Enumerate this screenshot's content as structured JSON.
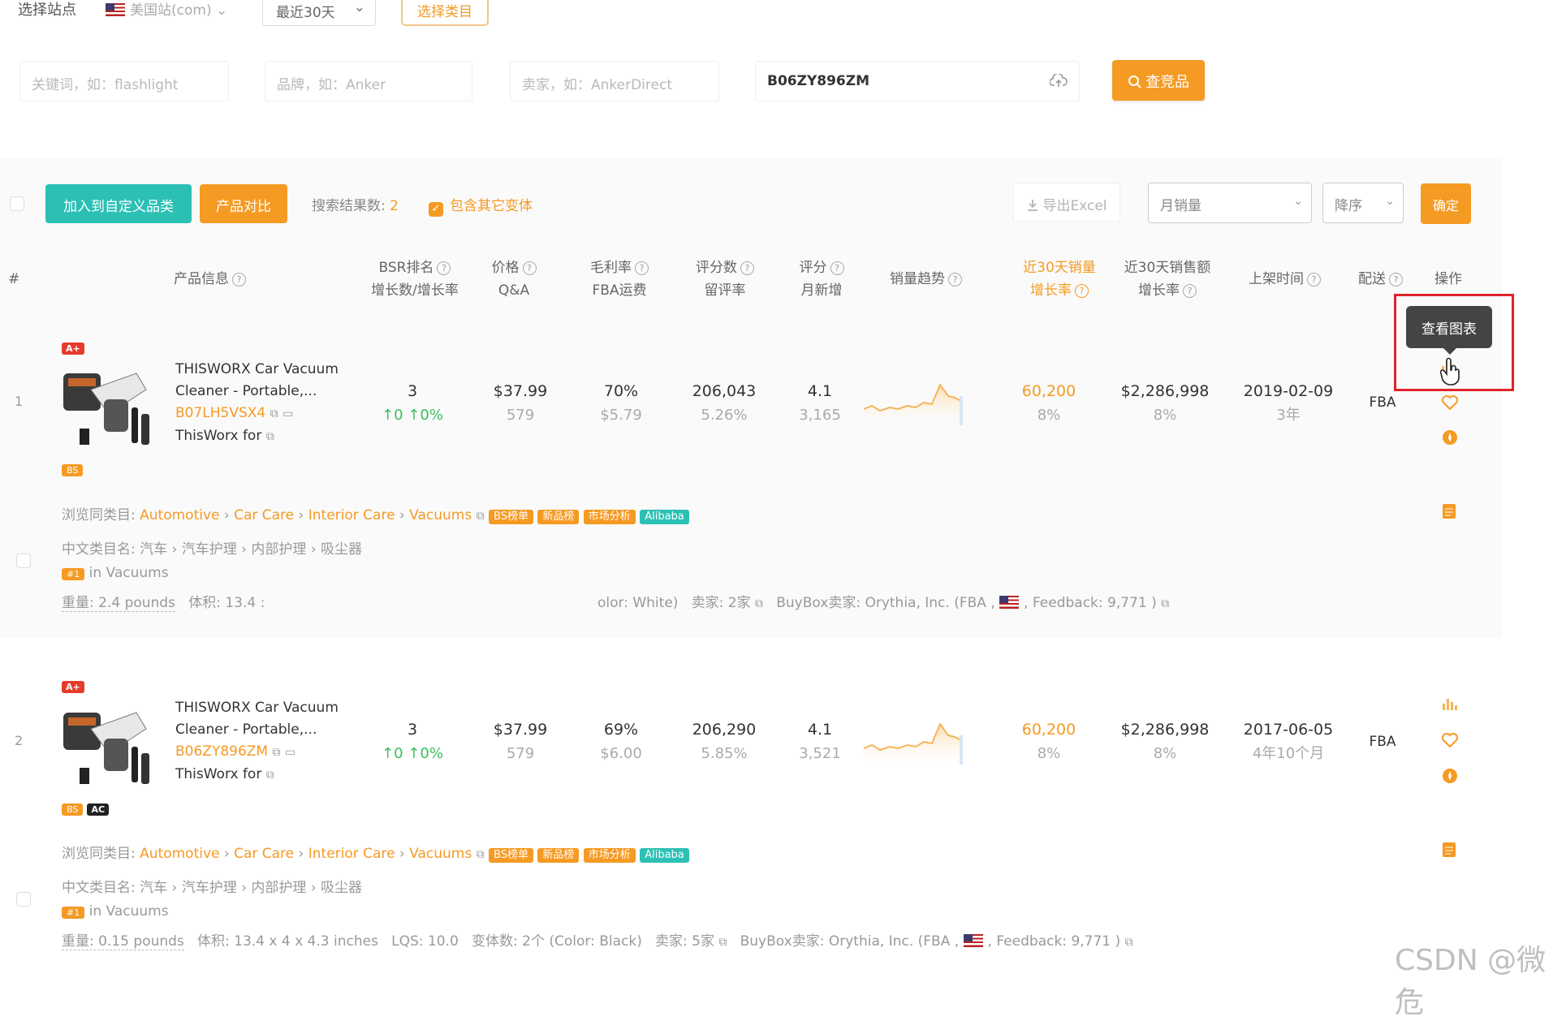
{
  "filters": {
    "site_label": "选择站点",
    "site_value": "美国站(com)",
    "range_value": "最近30天",
    "category_button": "选择类目"
  },
  "search": {
    "keyword_placeholder": "关键词，如：flashlight",
    "brand_placeholder": "品牌，如：Anker",
    "seller_placeholder": "卖家，如：AnkerDirect",
    "asin_value": "B06ZY896ZM",
    "query_button": "查竞品"
  },
  "toolbar": {
    "add_custom_category": "加入到自定义品类",
    "compare_products": "产品对比",
    "results_label": "搜索结果数:",
    "results_count": "2",
    "include_variants": "包含其它变体",
    "export_excel": "导出Excel",
    "sort_field": "月销量",
    "sort_order": "降序",
    "confirm": "确定"
  },
  "headers": {
    "index": "#",
    "product_info": "产品信息",
    "bsr_1": "BSR排名",
    "bsr_2": "增长数/增长率",
    "price_1": "价格",
    "price_2": "Q&A",
    "margin_1": "毛利率",
    "margin_2": "FBA运费",
    "reviews_1": "评分数",
    "reviews_2": "留评率",
    "rating_1": "评分",
    "rating_2": "月新增",
    "trend": "销量趋势",
    "sales30_1": "近30天销量",
    "sales30_2": "增长率",
    "revenue30_1": "近30天销售额",
    "revenue30_2": "增长率",
    "launch": "上架时间",
    "delivery": "配送",
    "actions": "操作"
  },
  "tooltip": "查看图表",
  "rows": [
    {
      "index": "1",
      "badge_top": "A+",
      "title_1": "THISWORX Car Vacuum",
      "title_2": "Cleaner - Portable,...",
      "asin": "B07LH5VSX4",
      "brand_line": "ThisWorx for",
      "badges_bottom": [
        "BS"
      ],
      "bsr": "3",
      "bsr_growth": "↑0  ↑0%",
      "price": "$37.99",
      "qa": "579",
      "margin": "70%",
      "fba_fee": "$5.79",
      "reviews": "206,043",
      "review_rate": "5.26%",
      "rating": "4.1",
      "rating_new": "3,165",
      "sales30": "60,200",
      "sales30_growth": "8%",
      "revenue30": "$2,286,998",
      "revenue30_growth": "8%",
      "launch_date": "2019-02-09",
      "launch_age": "3年",
      "delivery": "FBA",
      "browse_label": "浏览同类目:",
      "browse_path": [
        "Automotive",
        "Car Care",
        "Interior Care",
        "Vacuums"
      ],
      "tags": [
        "BS榜单",
        "新品榜",
        "市场分析",
        "Alibaba"
      ],
      "cn_label": "中文类目名:",
      "cn_path": "汽车 › 汽车护理 › 内部护理 › 吸尘器",
      "rank_badge": "#1",
      "rank_text": "in Vacuums",
      "weight": "重量: 2.4 pounds",
      "volume": "体积: 13.4 :",
      "color": "olor: White)",
      "sellers": "卖家: 2家",
      "buybox": "BuyBox卖家: Orythia, Inc.  (FBA ,",
      "feedback": ", Feedback: 9,771 )"
    },
    {
      "index": "2",
      "badge_top": "A+",
      "title_1": "THISWORX Car Vacuum",
      "title_2": "Cleaner - Portable,...",
      "asin": "B06ZY896ZM",
      "brand_line": "ThisWorx for",
      "badges_bottom": [
        "BS",
        "AC"
      ],
      "bsr": "3",
      "bsr_growth": "↑0  ↑0%",
      "price": "$37.99",
      "qa": "579",
      "margin": "69%",
      "fba_fee": "$6.00",
      "reviews": "206,290",
      "review_rate": "5.85%",
      "rating": "4.1",
      "rating_new": "3,521",
      "sales30": "60,200",
      "sales30_growth": "8%",
      "revenue30": "$2,286,998",
      "revenue30_growth": "8%",
      "launch_date": "2017-06-05",
      "launch_age": "4年10个月",
      "delivery": "FBA",
      "browse_label": "浏览同类目:",
      "browse_path": [
        "Automotive",
        "Car Care",
        "Interior Care",
        "Vacuums"
      ],
      "tags": [
        "BS榜单",
        "新品榜",
        "市场分析",
        "Alibaba"
      ],
      "cn_label": "中文类目名:",
      "cn_path": "汽车 › 汽车护理 › 内部护理 › 吸尘器",
      "rank_badge": "#1",
      "rank_text": "in Vacuums",
      "weight": "重量: 0.15 pounds",
      "volume": "体积: 13.4 x 4 x 4.3 inches",
      "lqs": "LQS: 10.0",
      "variants": "变体数: 2个 (Color: Black)",
      "sellers": "卖家: 5家",
      "buybox": "BuyBox卖家: Orythia, Inc.  (FBA ,",
      "feedback": ", Feedback: 9,771 )"
    }
  ],
  "watermark": "CSDN @微危",
  "colors": {
    "accent": "#f59a23",
    "teal": "#2cc0b4",
    "highlight": "#e2232a"
  },
  "icons": [
    "cloud-upload-icon",
    "search-icon",
    "download-icon",
    "chevron-down-icon",
    "help-icon",
    "bar-chart-icon",
    "heart-icon",
    "compass-icon",
    "document-icon",
    "external-link-icon",
    "comment-icon",
    "hand-cursor-icon"
  ]
}
